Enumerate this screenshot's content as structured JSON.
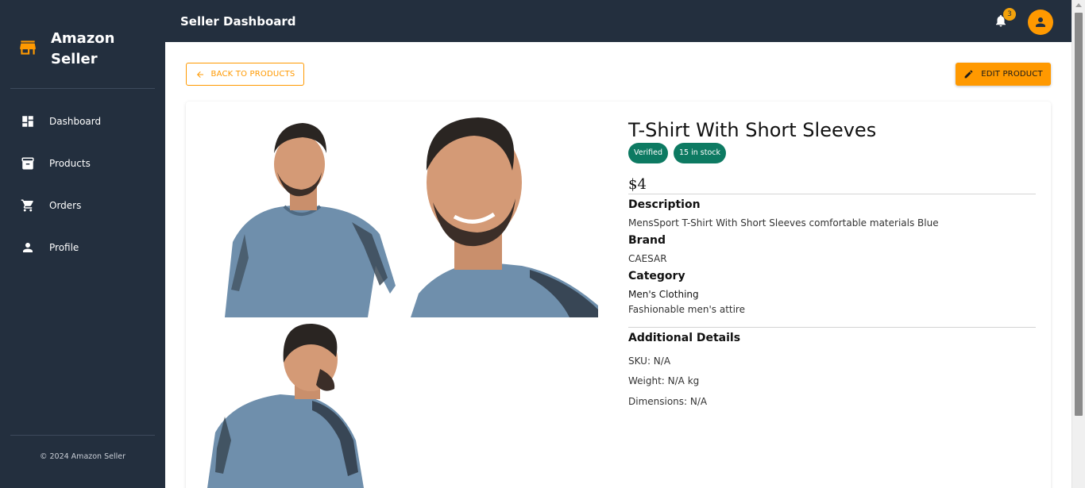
{
  "sidebar": {
    "brand": "Amazon Seller",
    "icon": "store-icon",
    "items": [
      {
        "label": "Dashboard",
        "icon": "dashboard-icon"
      },
      {
        "label": "Products",
        "icon": "archive-icon"
      },
      {
        "label": "Orders",
        "icon": "cart-icon"
      },
      {
        "label": "Profile",
        "icon": "person-icon"
      }
    ],
    "copyright": "© 2024 Amazon Seller"
  },
  "header": {
    "title": "Seller Dashboard",
    "notification_count": "3"
  },
  "actions": {
    "back_label": "BACK TO PRODUCTS",
    "edit_label": "EDIT PRODUCT"
  },
  "product": {
    "title": "T-Shirt With Short Sleeves",
    "chips": [
      "Verified",
      "15 in stock"
    ],
    "price": "$4",
    "description_label": "Description",
    "description": "MensSport T-Shirt With Short Sleeves comfortable materials Blue",
    "brand_label": "Brand",
    "brand": "CAESAR",
    "category_label": "Category",
    "category_name": "Men's Clothing",
    "category_desc": "Fashionable men's attire",
    "additional_label": "Additional Details",
    "sku": "SKU: N/A",
    "weight": "Weight: N/A kg",
    "dimensions": "Dimensions: N/A"
  },
  "colors": {
    "accent": "#ff9900",
    "sidebar_bg": "#232f3e",
    "chip_bg": "#0d7a62",
    "shirt": "#6f8fac"
  }
}
